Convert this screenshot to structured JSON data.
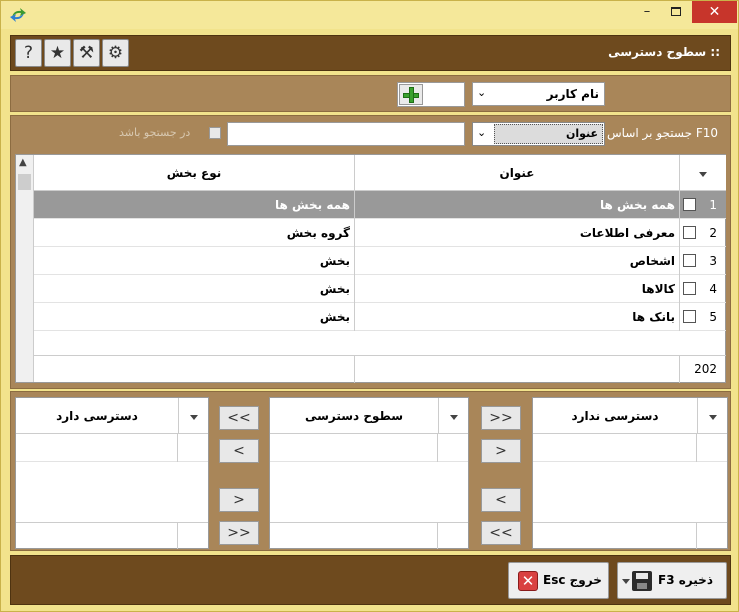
{
  "window": {
    "minimize_label": "–",
    "close_label": "✕"
  },
  "header": {
    "title": ":: سطوح دسترسی",
    "tools": [
      {
        "icon": "help-icon",
        "glyph": "?"
      },
      {
        "icon": "star-icon",
        "glyph": "★"
      },
      {
        "icon": "magic-wand-icon",
        "glyph": "⚒"
      },
      {
        "icon": "gear-icon",
        "glyph": "⚙"
      }
    ]
  },
  "user_bar": {
    "user_select_value": "نام کاربر"
  },
  "search": {
    "label": "F10 جستجو بر اساس :",
    "field_value": "عنوان",
    "input_value": "",
    "contains_label": "در جستجو باشد"
  },
  "grid": {
    "columns": {
      "type": "نوع بخش",
      "title": "عنوان"
    },
    "rows": [
      {
        "num": "1",
        "title": "همه بخش ها",
        "type": "همه بخش ها",
        "selected": true
      },
      {
        "num": "2",
        "title": "معرفی اطلاعات",
        "type": "گروه بخش",
        "selected": false
      },
      {
        "num": "3",
        "title": "اشخاص",
        "type": "بخش",
        "selected": false
      },
      {
        "num": "4",
        "title": "کالاها",
        "type": "بخش",
        "selected": false
      },
      {
        "num": "5",
        "title": "بانک ها",
        "type": "بخش",
        "selected": false
      }
    ],
    "footer_count": "202"
  },
  "access_lists": {
    "has_access_title": "دسترسی دارد",
    "levels_title": "سطوح دسترسی",
    "no_access_title": "دسترسی ندارد",
    "btn_all_left": "<<",
    "btn_one_left": "<",
    "btn_one_right": ">",
    "btn_all_right": ">>"
  },
  "footer": {
    "save_label": "ذخیره F3",
    "exit_label": "خروج Esc",
    "exit_icon_glyph": "✕"
  }
}
